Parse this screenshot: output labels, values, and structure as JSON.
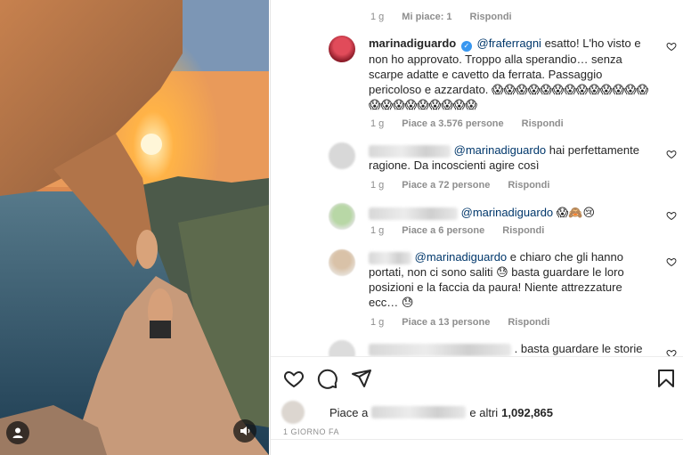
{
  "photo": {
    "tag_icon": "user-icon",
    "mute_icon": "speaker-icon"
  },
  "comments": {
    "top_meta": {
      "time": "1 g",
      "likes": "Mi piace: 1",
      "reply": "Rispondi"
    },
    "items": [
      {
        "user": "marinadiguardo",
        "verified": true,
        "mention": "@fraferragni",
        "text": "esatto! L'ho visto e non ho approvato. Troppo alla sperandio… senza scarpe adatte e cavetto da ferrata. Passaggio pericoloso e azzardato.",
        "emoji": "😱😱😱😱😱😱😱😱😱😱😱😱😱😱😱😱😱😱😱😱😱😱",
        "time": "1 g",
        "likes": "Piace a 3.576 persone",
        "reply": "Rispondi"
      },
      {
        "mention": "@marinadiguardo",
        "text": "hai perfettamente ragione. Da incoscienti agire così",
        "time": "1 g",
        "likes": "Piace a 72 persone",
        "reply": "Rispondi"
      },
      {
        "mention": "@marinadiguardo",
        "emoji": "😱🙈😢",
        "time": "1 g",
        "likes": "Piace a 6 persone",
        "reply": "Rispondi"
      },
      {
        "mention": "@marinadiguardo",
        "text": "e chiaro che gli hanno portati, non ci sono saliti 😓 basta guardare le loro posizioni e la faccia da paura! Niente attrezzature ecc… 😓",
        "time": "1 g",
        "likes": "Piace a 13 persone",
        "reply": "Rispondi"
      },
      {
        "text": ". basta guardare le storie"
      }
    ]
  },
  "actions": {
    "like_icon": "heart-icon",
    "comment_icon": "comment-icon",
    "share_icon": "paper-plane-icon",
    "save_icon": "bookmark-icon",
    "likes_prefix": "Piace a",
    "likes_suffix": "e altri",
    "likes_count": "1,092,865",
    "time_ago": "1 GIORNO FA"
  },
  "colors": {
    "mention": "#00376b",
    "meta": "#8e8e8e",
    "verified": "#3897f0",
    "text": "#262626"
  }
}
